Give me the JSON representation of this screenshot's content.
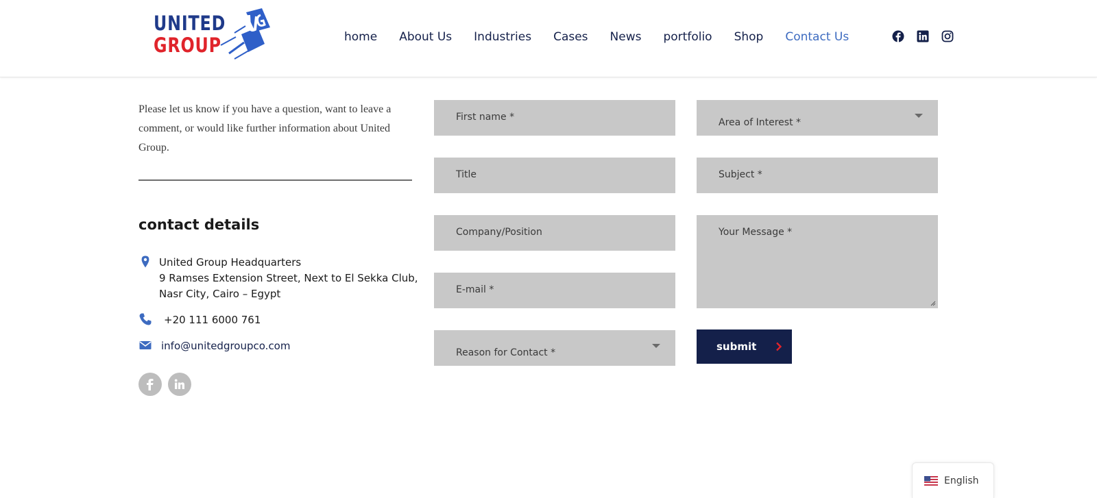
{
  "header": {
    "logo": {
      "line1": "UNITED",
      "line2": "GROUP",
      "mark": "UG"
    },
    "nav": [
      {
        "label": "home"
      },
      {
        "label": "About Us"
      },
      {
        "label": "Industries"
      },
      {
        "label": "Cases"
      },
      {
        "label": "News"
      },
      {
        "label": "portfolio"
      },
      {
        "label": "Shop"
      },
      {
        "label": "Contact Us",
        "active": true
      }
    ],
    "social_icons": [
      "facebook-icon",
      "linkedin-icon",
      "instagram-icon"
    ]
  },
  "intro": {
    "text": "Please let us know if you have a question, want to leave a comment, or would like further information about United Group."
  },
  "contact_details": {
    "title": "contact details",
    "address_line1": "United Group Headquarters",
    "address_line2": "9 Ramses Extension Street, Next to El Sekka Club,",
    "address_line3": "Nasr City, Cairo – Egypt",
    "phone": "+20 111 6000 761",
    "email": "info@unitedgroupco.com",
    "social_icons": [
      "facebook-icon",
      "linkedin-icon"
    ]
  },
  "form": {
    "first_name": "First name *",
    "title": "Title",
    "company": "Company/Position",
    "email": "E-mail *",
    "reason": "Reason for Contact *",
    "area": "Area of Interest *",
    "subject": "Subject *",
    "message": "Your Message *",
    "submit": "submit"
  },
  "language": {
    "label": "English",
    "flag": "us-flag-icon"
  },
  "colors": {
    "navy": "#14204a",
    "accent_blue": "#3d6bc0",
    "logo_red": "#e0242b",
    "field_bg": "#c8c8c8",
    "social_grey": "#bdbdbd"
  }
}
